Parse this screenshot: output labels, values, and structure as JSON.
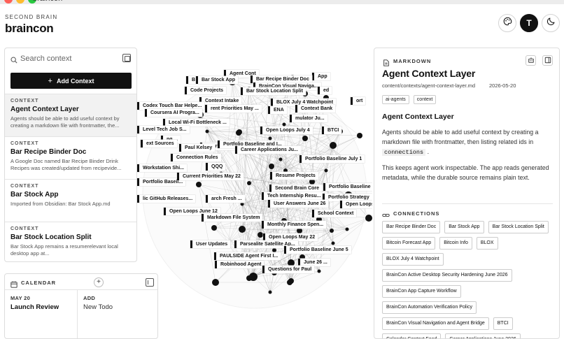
{
  "window": {
    "title": "braincon"
  },
  "brand": {
    "kicker": "SECOND BRAIN",
    "title": "braincon"
  },
  "header": {
    "buttons": [
      {
        "name": "palette-icon"
      },
      {
        "name": "theme-initial",
        "label": "T"
      },
      {
        "name": "moon-icon"
      }
    ]
  },
  "sidebar": {
    "search": {
      "placeholder": "Search context",
      "value": ""
    },
    "add_button": "Add Context",
    "items": [
      {
        "kicker": "CONTEXT",
        "title": "Agent Context Layer",
        "desc": "Agents should be able to add useful context by creating a markdown file with frontmatter, the...",
        "active": true
      },
      {
        "kicker": "CONTEXT",
        "title": "Bar Recipe Binder Doc",
        "desc": "A Google Doc named Bar Recipe Binder Drink Recipes was created/updated from recipevide...",
        "active": false
      },
      {
        "kicker": "CONTEXT",
        "title": "Bar Stock App",
        "desc": "Imported from Obsidian: Bar Stock App.md",
        "active": false
      },
      {
        "kicker": "CONTEXT",
        "title": "Bar Stock Location Split",
        "desc": "Bar Stock App remains a resumerelevant local desktop app at...",
        "active": false
      }
    ]
  },
  "calendar": {
    "label": "CALENDAR",
    "columns": [
      {
        "date": "MAY 20",
        "event": "Launch Review"
      },
      {
        "date": "ADD",
        "event": "New Todo"
      }
    ]
  },
  "graph": {
    "labels": [
      "Agent Cont",
      "App",
      "Bl",
      "Bar Stock App",
      "Bar Recipe Binder Doc",
      "BrainCon Visual Naviga...",
      "Code Projects",
      "Bar Stock Location Split",
      "ed",
      "Context Intake",
      "BLOX July 4 Watchpoint",
      "ort",
      "Codex Touch Bar Helpe...",
      "rent Priorities May ...",
      "ENA",
      "Context Bank",
      "Coursera AI Progra...",
      "mulator Ju...",
      "Local Wi-Fi Bottleneck ...",
      "Level Tech Job S...",
      "Open Loops July 4",
      "BTCI",
      "BrainCon Active Deskt...",
      "ng ...",
      "ext Sources",
      "Portfolio Baseline and I...",
      "Paul Kelsey",
      "Career Applications Ju...",
      "Connection Rules",
      "Portfolio Baseline July 1",
      "Workstation Shi...",
      "QQQ",
      "Portfolio Baseli...",
      "Current Priorities May 22",
      "Resume Projects",
      "Second Brain Core",
      "Portfolio Baseline",
      "Tech Internship Resu...",
      "Portfolio Strategy",
      "lic GitHub Releases...",
      "arch Fresh ...",
      "User Answers June 26",
      "Open Loops",
      "Open Loops June 12",
      "School Context",
      "Markdown File System",
      "Monthly Finance Spen...",
      "Open Loops May 22",
      "User Updates",
      "Parsealite Satellite Ap...",
      "Portfolio Baseline June 5",
      "PAULSIDE Agent First I...",
      "Robinhood Agent",
      "June 26 ...",
      "Questions for Paul"
    ]
  },
  "detail": {
    "type_label": "MARKDOWN",
    "title": "Agent Context Layer",
    "path": "content/contexts/agent-context-layer.md",
    "date": "2026-05-20",
    "tags": [
      "ai-agents",
      "context"
    ],
    "heading": "Agent Context Layer",
    "p1_pre": "Agents should be able to add useful context by creating a markdown file with frontmatter, then listing related ids in",
    "p1_code": "connections",
    "p1_post": ".",
    "p2": "This keeps agent work inspectable. The app reads generated metadata, while the durable source remains plain text.",
    "connections_label": "CONNECTIONS",
    "connections": [
      "Bar Recipe Binder Doc",
      "Bar Stock App",
      "Bar Stock Location Split",
      "Bitcoin Forecast App",
      "Bitcoin Info",
      "BLOX",
      "BLOX July 4 Watchpoint",
      "BrainCon Active Desktop Security Hardening June 2026",
      "BrainCon App Capture Workflow",
      "BrainCon Automation Verification Policy",
      "BrainCon Visual Navigation and Agent Bridge",
      "BTCI",
      "Calendar Context Feed",
      "Career Applications June 2026"
    ]
  }
}
